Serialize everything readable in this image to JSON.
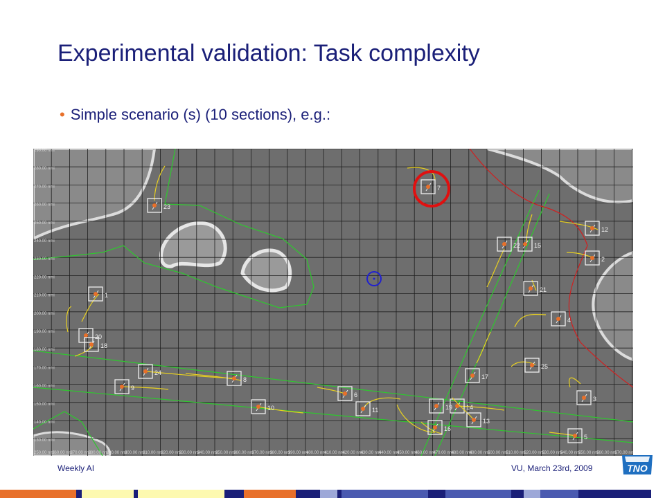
{
  "slide": {
    "title": "Experimental validation: Task complexity",
    "bullet": "Simple scenario (s) (10 sections), e.g.:",
    "footer_left": "Weekly AI",
    "footer_right": "VU, March 23rd, 2009",
    "logo_text": "TNO"
  },
  "radar": {
    "y_axis_labels": [
      "290.00 nmi",
      "280.00 nmi",
      "270.00 nmi",
      "260.00 nmi",
      "250.00 nmi",
      "240.00 nmi",
      "230.00 nmi",
      "220.00 nmi",
      "210.00 nmi",
      "200.00 nmi",
      "190.00 nmi",
      "180.00 nmi",
      "170.00 nmi",
      "160.00 nmi",
      "150.00 nmi",
      "140.00 nmi",
      "130.00 nmi"
    ],
    "x_axis_labels": [
      "250.00 nmi",
      "260.00 nmi",
      "270.00 nmi",
      "280.00 nmi",
      "290.00 nmi",
      "300.00 nmi",
      "310.00 nmi",
      "320.00 nmi",
      "330.00 nmi",
      "340.00 nmi",
      "350.00 nmi",
      "360.00 nmi",
      "370.00 nmi",
      "380.00 nmi",
      "390.00 nmi",
      "400.00 nmi",
      "410.00 nmi",
      "420.00 nmi",
      "430.00 nmi",
      "440.00 nmi",
      "450.00 nmi",
      "460.00 nmi",
      "470.00 nmi",
      "480.00 nmi",
      "490.00 nmi",
      "500.00 nmi",
      "510.00 nmi",
      "520.00 nmi",
      "530.00 nmi",
      "540.00 nmi",
      "550.00 nmi",
      "560.00 nmi",
      "570.00 nmi",
      "580.00 nmi"
    ],
    "aircraft_labels": [
      "7",
      "23",
      "12",
      "22",
      "15",
      "2",
      "1",
      "21",
      "20",
      "18",
      "4",
      "24",
      "8",
      "9",
      "25",
      "17",
      "6",
      "11",
      "10",
      "19",
      "14",
      "13",
      "16",
      "3",
      "5"
    ]
  },
  "colors": {
    "title": "#1a1f78",
    "bullet_marker": "#e8702a",
    "radar_background": "#6e6e6e",
    "sector_line": "#2ec82e",
    "restricted_line": "#d02020",
    "track_line": "#e8d020",
    "aircraft": "#e8702a",
    "highlight_circle": "#e01010",
    "cursor": "#2020d0"
  }
}
